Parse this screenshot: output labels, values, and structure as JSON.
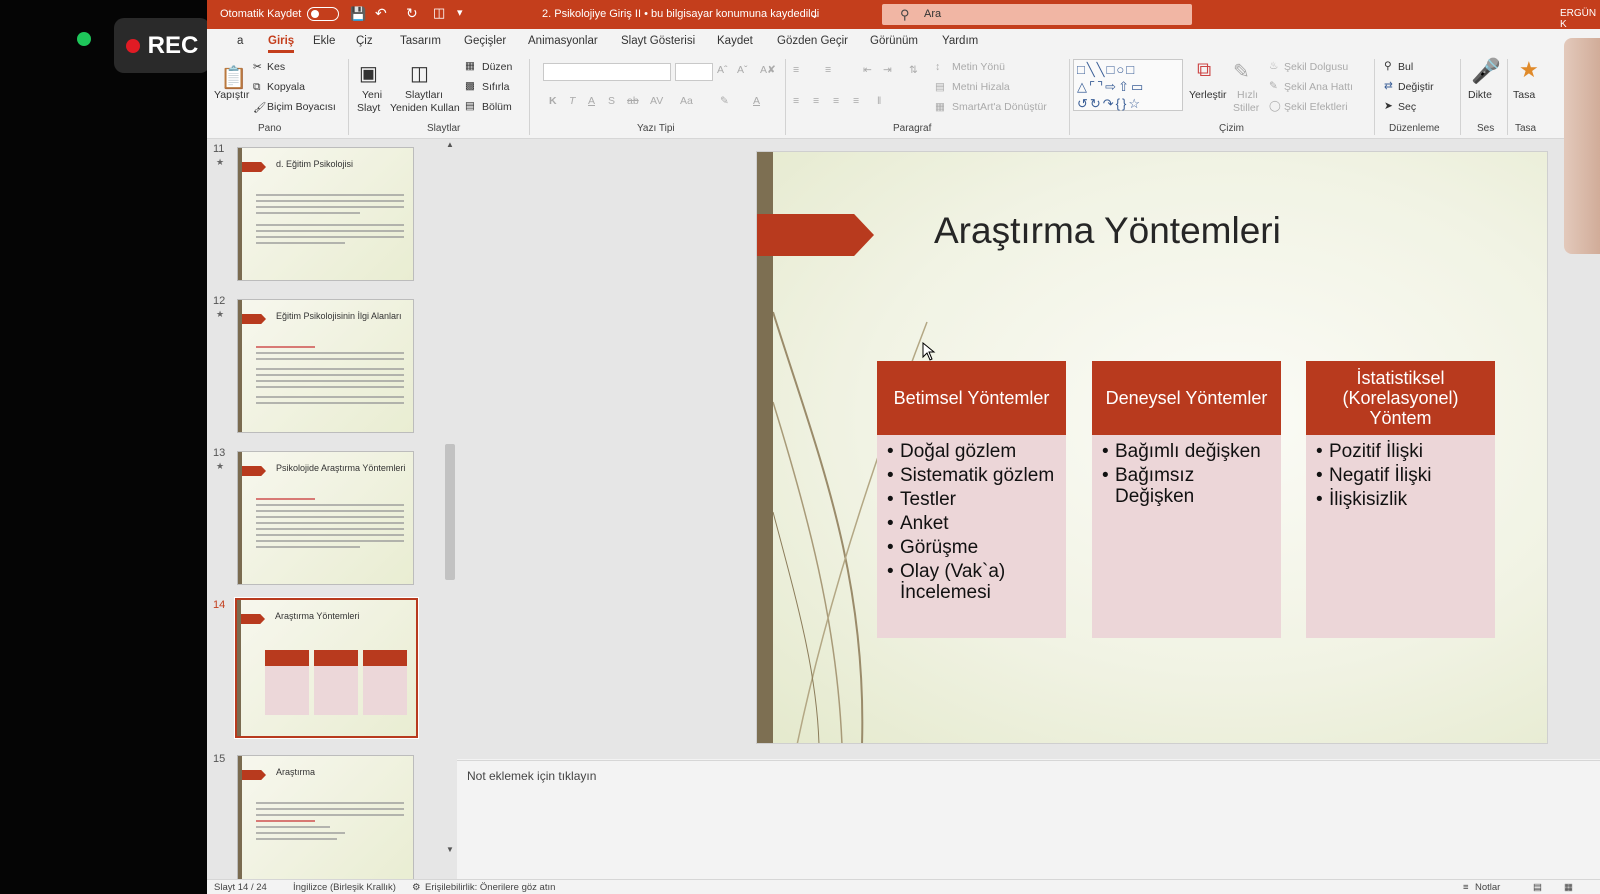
{
  "overlay": {
    "rec_label": "REC"
  },
  "titlebar": {
    "autosave": "Otomatik Kaydet",
    "doc_title": "2. Psikolojiye Giriş II  •  bu bilgisayar konumuna kaydedildi",
    "search_placeholder": "Ara",
    "user": "ERGÜN K"
  },
  "tabs": [
    "a",
    "Giriş",
    "Ekle",
    "Çiz",
    "Tasarım",
    "Geçişler",
    "Animasyonlar",
    "Slayt Gösterisi",
    "Kaydet",
    "Gözden Geçir",
    "Görünüm",
    "Yardım"
  ],
  "ribbon": {
    "pano": {
      "paste": "Yapıştır",
      "cut": "Kes",
      "copy": "Kopyala",
      "format_painter": "Biçim Boyacısı",
      "group": "Pano"
    },
    "slaytlar": {
      "new_slide_1": "Yeni",
      "new_slide_2": "Slayt",
      "reuse_1": "Slaytları",
      "reuse_2": "Yeniden Kullan",
      "layout": "Düzen",
      "reset": "Sıfırla",
      "section": "Bölüm",
      "group": "Slaytlar"
    },
    "yazi_tipi": {
      "group": "Yazı Tipi",
      "bold": "K",
      "italic": "T",
      "underline": "A",
      "shadow": "S",
      "strike": "ab",
      "spacing": "AV",
      "case": "Aa"
    },
    "paragraf": {
      "direction": "Metin Yönü",
      "align": "Metni Hizala",
      "smartart": "SmartArt'a Dönüştür",
      "group": "Paragraf"
    },
    "cizim": {
      "arrange": "Yerleştir",
      "quick_1": "Hızlı",
      "quick_2": "Stiller",
      "fill": "Şekil Dolgusu",
      "outline": "Şekil Ana Hattı",
      "effects": "Şekil Efektleri",
      "group": "Çizim"
    },
    "duzenleme": {
      "find": "Bul",
      "replace": "Değiştir",
      "select": "Seç",
      "group": "Düzenleme"
    },
    "ses": {
      "dictate": "Dikte",
      "group": "Ses"
    },
    "tasarimci": {
      "label": "Tasa",
      "group": "Tasa"
    }
  },
  "thumbnails": [
    {
      "num": "11",
      "title": "d. Eğitim Psikolojisi"
    },
    {
      "num": "12",
      "title": "Eğitim Psikolojisinin İlgi Alanları"
    },
    {
      "num": "13",
      "title": "Psikolojide Araştırma Yöntemleri"
    },
    {
      "num": "14",
      "title": "Araştırma Yöntemleri"
    },
    {
      "num": "15",
      "title": "Araştırma"
    }
  ],
  "slide": {
    "title": "Araştırma Yöntemleri",
    "columns": [
      {
        "head": "Betimsel Yöntemler",
        "items": [
          "Doğal gözlem",
          "Sistematik gözlem",
          "Testler",
          "Anket",
          "Görüşme",
          "Olay (Vak`a) İncelemesi"
        ]
      },
      {
        "head": "Deneysel Yöntemler",
        "items": [
          "Bağımlı değişken",
          "Bağımsız Değişken"
        ]
      },
      {
        "head": "İstatistiksel (Korelasyonel) Yöntem",
        "items": [
          "Pozitif İlişki",
          "Negatif İlişki",
          "İlişkisizlik"
        ]
      }
    ]
  },
  "notes": {
    "placeholder": "Not eklemek için tıklayın"
  },
  "status": {
    "slide": "Slayt 14 / 24",
    "language": "İngilizce (Birleşik Krallık)",
    "accessibility": "Erişilebilirlik: Önerilere göz atın",
    "notes": "Notlar"
  },
  "colors": {
    "accent": "#c43e1c",
    "slide_red": "#b83a1e",
    "box_pink": "#ecd6d8"
  }
}
